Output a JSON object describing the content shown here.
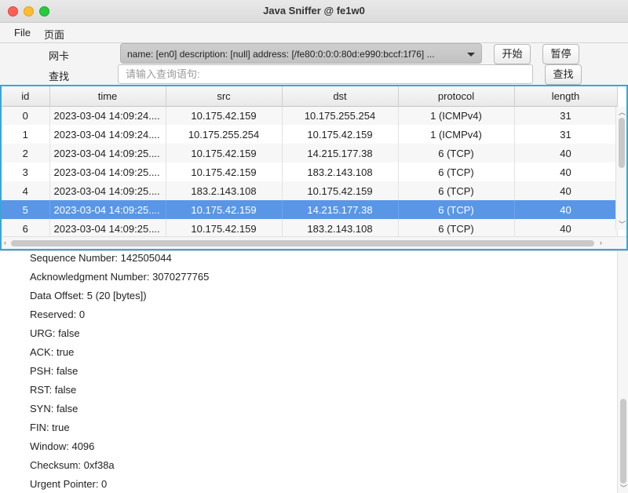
{
  "window": {
    "title": "Java Sniffer @ fe1w0"
  },
  "menu": {
    "file": "File",
    "page": "页面"
  },
  "toolbar": {
    "nic_label": "网卡",
    "nic_value": "name: [en0] description: [null] address: [/fe80:0:0:0:80d:e990:bccf:1f76] ...",
    "start_label": "开始",
    "pause_label": "暂停",
    "search_label": "查找",
    "search_placeholder": "请输入查询语句:",
    "search_value": "",
    "search_button": "查找"
  },
  "table": {
    "columns": [
      "id",
      "time",
      "src",
      "dst",
      "protocol",
      "length"
    ],
    "selected_index": 5,
    "rows": [
      {
        "id": "0",
        "time": "2023-03-04 14:09:24....",
        "src": "10.175.42.159",
        "dst": "10.175.255.254",
        "protocol": "1 (ICMPv4)",
        "length": "31"
      },
      {
        "id": "1",
        "time": "2023-03-04 14:09:24....",
        "src": "10.175.255.254",
        "dst": "10.175.42.159",
        "protocol": "1 (ICMPv4)",
        "length": "31"
      },
      {
        "id": "2",
        "time": "2023-03-04 14:09:25....",
        "src": "10.175.42.159",
        "dst": "14.215.177.38",
        "protocol": "6 (TCP)",
        "length": "40"
      },
      {
        "id": "3",
        "time": "2023-03-04 14:09:25....",
        "src": "10.175.42.159",
        "dst": "183.2.143.108",
        "protocol": "6 (TCP)",
        "length": "40"
      },
      {
        "id": "4",
        "time": "2023-03-04 14:09:25....",
        "src": "183.2.143.108",
        "dst": "10.175.42.159",
        "protocol": "6 (TCP)",
        "length": "40"
      },
      {
        "id": "5",
        "time": "2023-03-04 14:09:25....",
        "src": "10.175.42.159",
        "dst": "14.215.177.38",
        "protocol": "6 (TCP)",
        "length": "40"
      },
      {
        "id": "6",
        "time": "2023-03-04 14:09:25....",
        "src": "10.175.42.159",
        "dst": "183.2.143.108",
        "protocol": "6 (TCP)",
        "length": "40"
      }
    ]
  },
  "details": {
    "lines": [
      "Sequence Number: 142505044",
      "Acknowledgment Number: 3070277765",
      "Data Offset: 5 (20 [bytes])",
      "Reserved: 0",
      "URG: false",
      "ACK: true",
      "PSH: false",
      "RST: false",
      "SYN: false",
      "FIN: true",
      "Window: 4096",
      "Checksum: 0xf38a",
      "Urgent Pointer: 0"
    ]
  },
  "icons": {
    "close": "close-icon",
    "minimize": "minimize-icon",
    "zoom": "zoom-icon",
    "dropdown": "chevron-down-icon"
  },
  "colors": {
    "selection": "#5a96e6",
    "focus_border": "#3aa6d8"
  }
}
